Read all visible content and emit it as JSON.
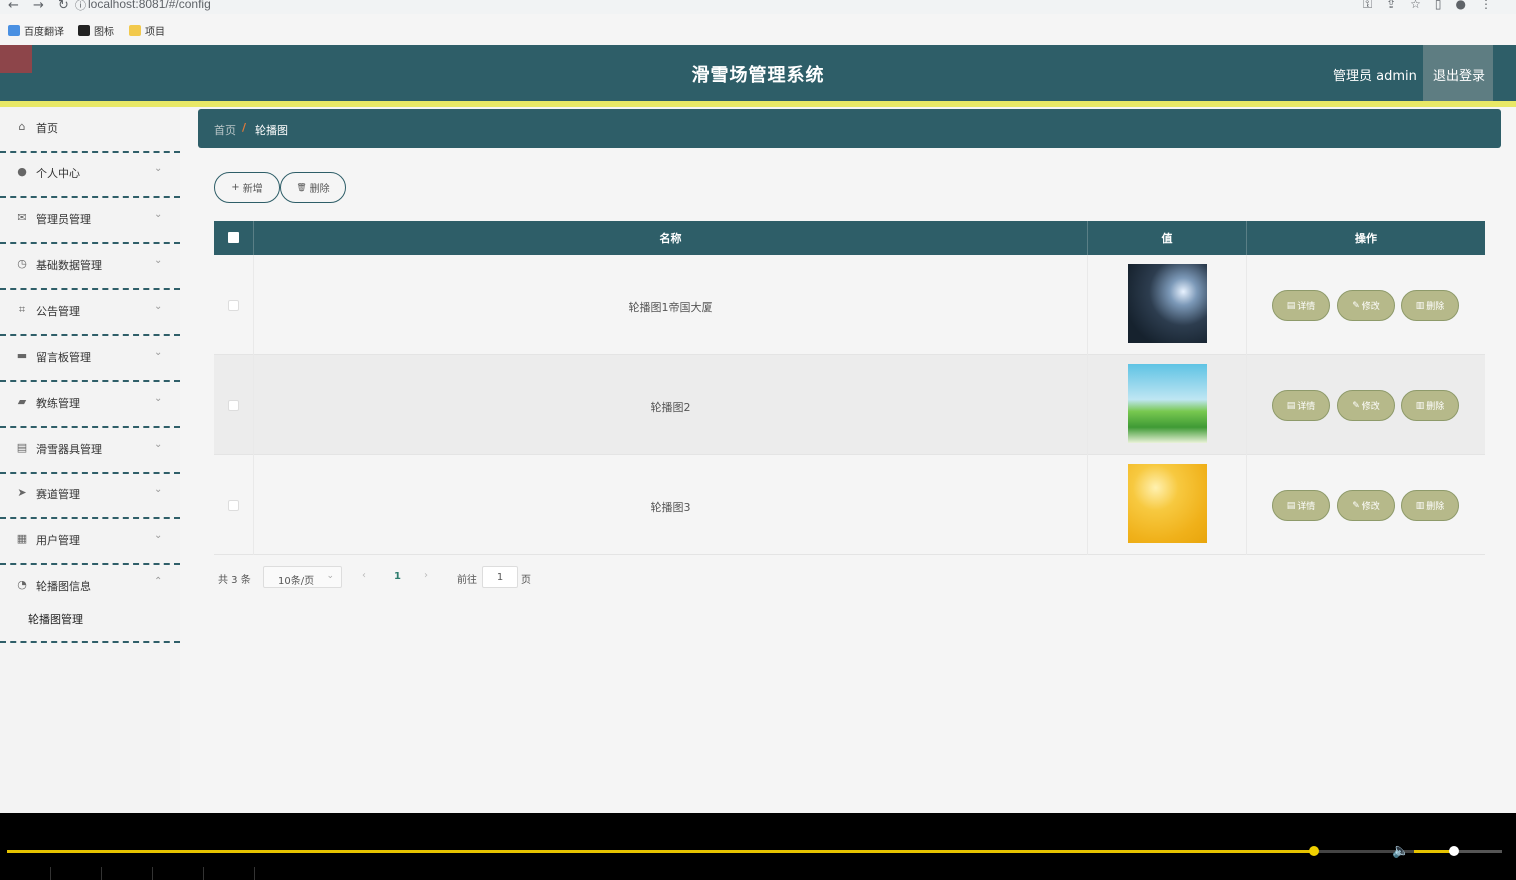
{
  "browser": {
    "url": "localhost:8081/#/config",
    "bookmarks": [
      {
        "label": "百度翻译",
        "color": "#4a90e2"
      },
      {
        "label": "图标",
        "color": "#222222"
      },
      {
        "label": "项目",
        "color": "#f2c94c"
      }
    ]
  },
  "header": {
    "title": "滑雪场管理系统",
    "user": "管理员 admin",
    "logout": "退出登录"
  },
  "sidebar": {
    "items": [
      {
        "label": "首页",
        "icon": "home-icon",
        "glyph": "⌂",
        "chevron": ""
      },
      {
        "label": "个人中心",
        "icon": "user-icon",
        "glyph": "●",
        "chevron": "⌄"
      },
      {
        "label": "管理员管理",
        "icon": "mail-icon",
        "glyph": "✉",
        "chevron": "⌄"
      },
      {
        "label": "基础数据管理",
        "icon": "gauge-icon",
        "glyph": "◷",
        "chevron": "⌄"
      },
      {
        "label": "公告管理",
        "icon": "crop-icon",
        "glyph": "⌗",
        "chevron": "⌄"
      },
      {
        "label": "留言板管理",
        "icon": "briefcase-icon",
        "glyph": "▬",
        "chevron": "⌄"
      },
      {
        "label": "教练管理",
        "icon": "ticket-icon",
        "glyph": "▰",
        "chevron": "⌄"
      },
      {
        "label": "滑雪器具管理",
        "icon": "printer-icon",
        "glyph": "▤",
        "chevron": "⌄"
      },
      {
        "label": "赛道管理",
        "icon": "send-icon",
        "glyph": "➤",
        "chevron": "⌄"
      },
      {
        "label": "用户管理",
        "icon": "clipboard-icon",
        "glyph": "▦",
        "chevron": "⌄"
      },
      {
        "label": "轮播图信息",
        "icon": "clock-icon",
        "glyph": "◔",
        "chevron": "⌃"
      }
    ],
    "sub_item": "轮播图管理"
  },
  "breadcrumb": {
    "home": "首页",
    "separator": "/",
    "current": "轮播图"
  },
  "toolbar": {
    "add": "新增",
    "add_icon": "+",
    "delete": "删除",
    "delete_icon": "🗑"
  },
  "table": {
    "columns": [
      "名称",
      "值",
      "操作"
    ],
    "rows": [
      {
        "name": "轮播图1帝国大厦",
        "thumb": "dark-abstract"
      },
      {
        "name": "轮播图2",
        "thumb": "cartoon-meadow"
      },
      {
        "name": "轮播图3",
        "thumb": "golden-glow"
      }
    ],
    "actions": {
      "detail": "详情",
      "edit": "修改",
      "delete": "删除"
    }
  },
  "pagination": {
    "total": "共 3 条",
    "page_size": "10条/页",
    "current_page": "1",
    "goto_label": "前往",
    "goto_value": "1",
    "goto_unit": "页"
  },
  "video_player": {
    "progress": 0.874,
    "volume": 0.45
  },
  "colors": {
    "primary": "#2e5e68",
    "accent_yellow": "#e8e866",
    "action_button": "#b6b98a"
  }
}
